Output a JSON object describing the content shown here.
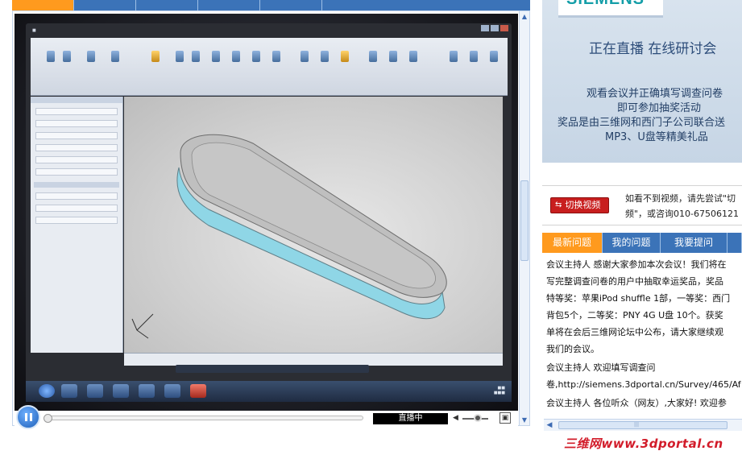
{
  "player": {
    "live_label": "直播中"
  },
  "banner": {
    "brand": "SIEMENS",
    "live_title": "正在直播  在线研讨会",
    "lines": [
      "观看会议并正确填写调查问卷",
      "即可参加抽奖活动",
      "奖品是由三维网和西门子公司联合送",
      "MP3、U盘等精美礼品"
    ]
  },
  "switch_video": {
    "button_label": "切换视频",
    "hint_lines": [
      "如看不到视频，请先尝试\"切",
      "频\"，或咨询010-67506121"
    ]
  },
  "qa_tabs": [
    {
      "label": "最新问题"
    },
    {
      "label": "我的问题"
    },
    {
      "label": "我要提问"
    }
  ],
  "messages": [
    {
      "lines": [
        "会议主持人 感谢大家参加本次会议！我们将在",
        "写完整调查问卷的用户中抽取幸运奖品，奖品",
        "特等奖：苹果iPod shuffle 1部，一等奖：西门",
        "背包5个，二等奖：PNY 4G U盘 10个。获奖",
        "单将在会后三维网论坛中公布，请大家继续观",
        "我们的会议。"
      ]
    },
    {
      "lines": [
        "会议主持人 欢迎填写调查问",
        "卷,http://siemens.3dportal.cn/Survey/465/Af"
      ]
    },
    {
      "lines": [
        "会议主持人 各位听众（网友）,大家好! 欢迎参"
      ]
    }
  ],
  "watermark": "三维网www.3dportal.cn",
  "colors": {
    "tab_blue": "#3b73b8",
    "tab_orange": "#ff9a1e",
    "switch_red": "#c81e1e",
    "banner_text": "#2d4d7a"
  }
}
